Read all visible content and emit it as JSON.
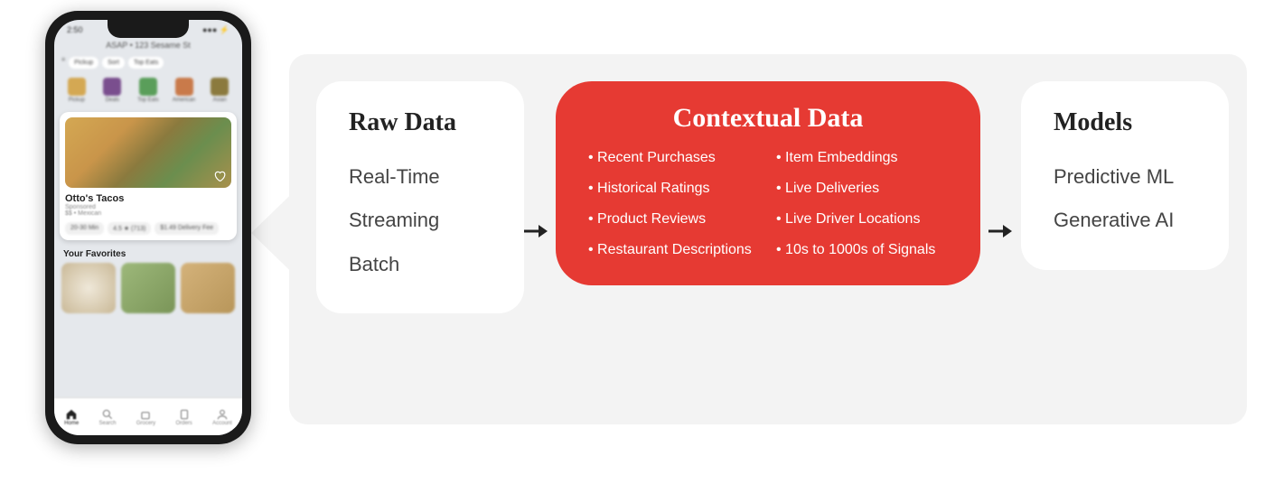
{
  "phone": {
    "status_time": "2:50",
    "header": "ASAP • 123 Sesame St",
    "filters": [
      "Pickup",
      "Sort",
      "Top Eats"
    ],
    "categories": [
      "Pickup",
      "Deals",
      "Top Eats",
      "American",
      "Asian"
    ],
    "card": {
      "name": "Otto's Tacos",
      "subtitle": "Sponsored",
      "subline": "$$ • Mexican",
      "stats": [
        "20-30 Min",
        "4.5 ★ (713)",
        "$1.49 Delivery Fee"
      ]
    },
    "section": "Your Favorites",
    "tabs": [
      "Home",
      "Search",
      "Grocery",
      "Orders",
      "Account"
    ]
  },
  "raw_data": {
    "title": "Raw Data",
    "items": [
      "Real-Time",
      "Streaming",
      "Batch"
    ]
  },
  "contextual": {
    "title": "Contextual Data",
    "col1": [
      "Recent Purchases",
      "Historical Ratings",
      "Product Reviews",
      "Restaurant Descriptions"
    ],
    "col2": [
      "Item Embeddings",
      "Live Deliveries",
      "Live Driver Locations",
      "10s to 1000s of Signals"
    ]
  },
  "models": {
    "title": "Models",
    "items": [
      "Predictive ML",
      "Generative AI"
    ]
  }
}
